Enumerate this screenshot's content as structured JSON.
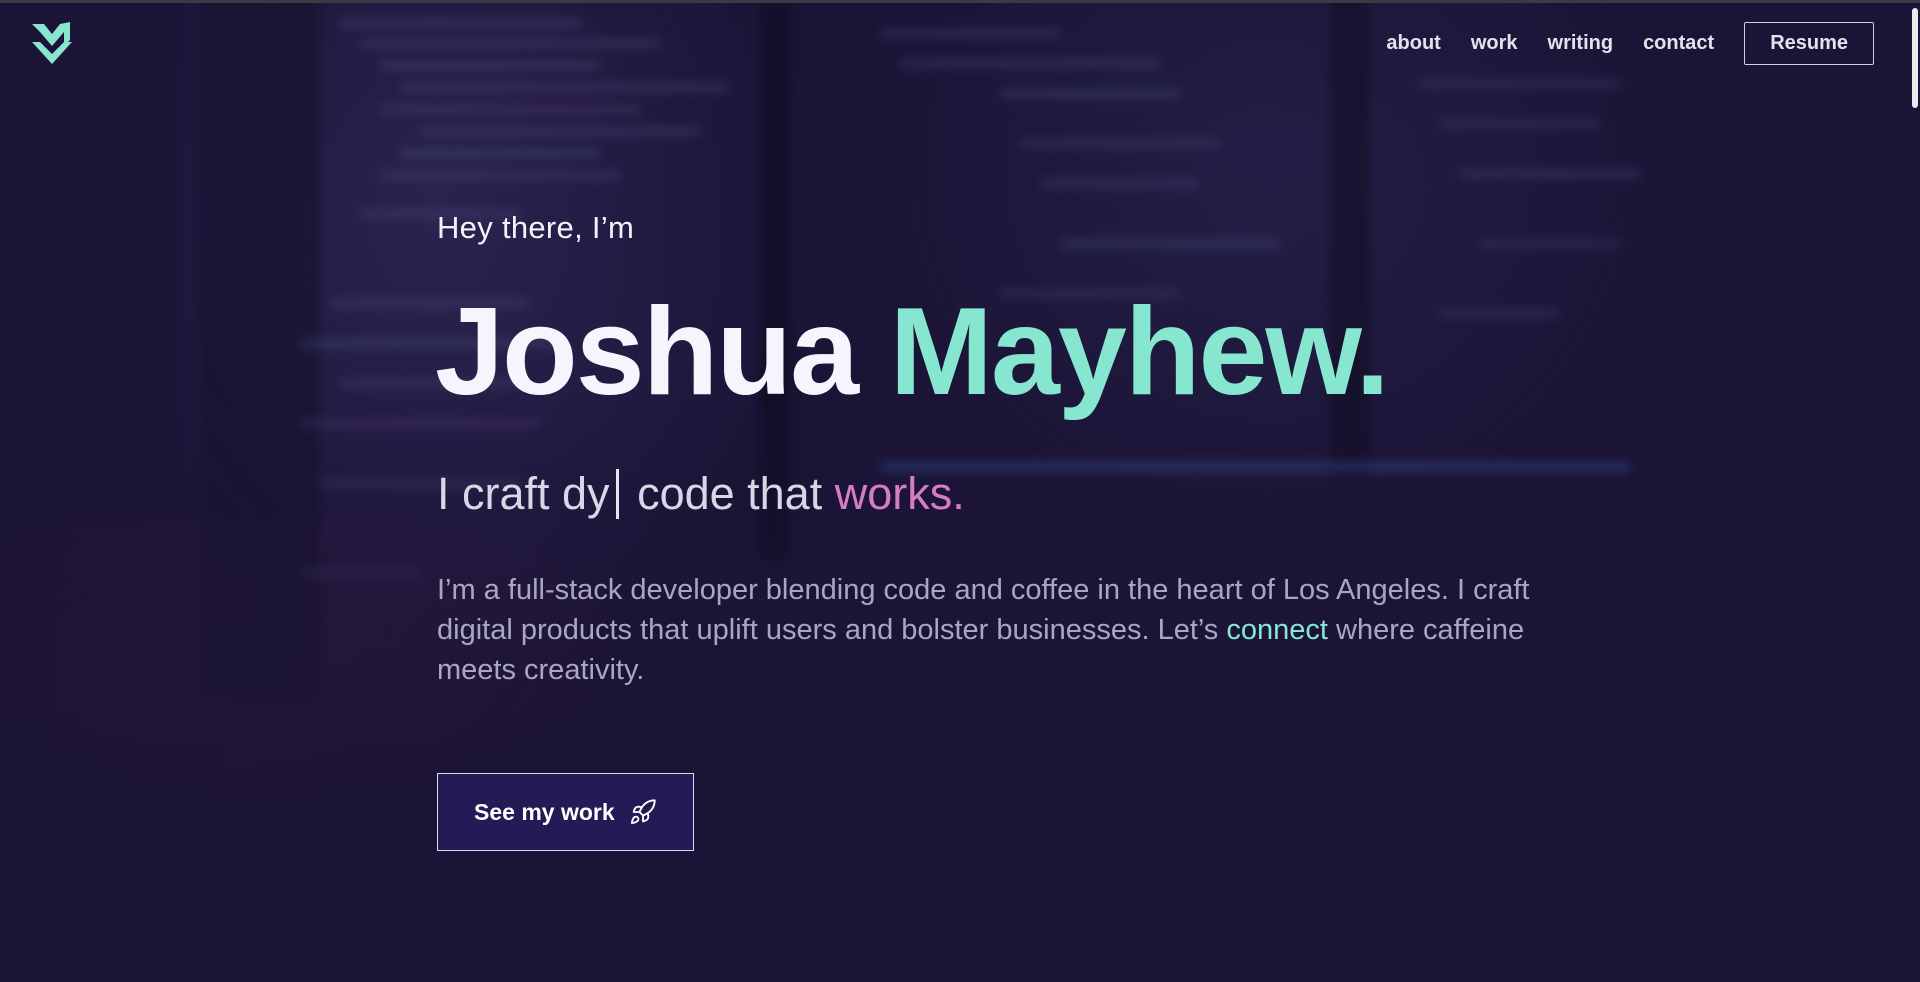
{
  "header": {
    "logo_icon": "jm-monogram-logo",
    "nav": [
      {
        "label": "about"
      },
      {
        "label": "work"
      },
      {
        "label": "writing"
      },
      {
        "label": "contact"
      }
    ],
    "resume_label": "Resume"
  },
  "hero": {
    "greeting": "Hey there, I’m",
    "name_first": "Joshua",
    "name_last": "Mayhew.",
    "tagline_typed": "I craft dy",
    "tagline_rest": " code that ",
    "tagline_accent": "works.",
    "bio_before": "I’m a full-stack developer blending code and coffee in the heart of Los Angeles. I craft digital products that uplift users and bolster businesses. Let’s ",
    "bio_link": "connect",
    "bio_after": " where caffeine meets creativity.",
    "cta_label": "See my work",
    "cta_icon": "rocket-icon"
  },
  "colors": {
    "background": "#1b1436",
    "accent_mint": "#86e6cf",
    "accent_pink": "#d57cc4",
    "button_bg": "#231b55"
  }
}
